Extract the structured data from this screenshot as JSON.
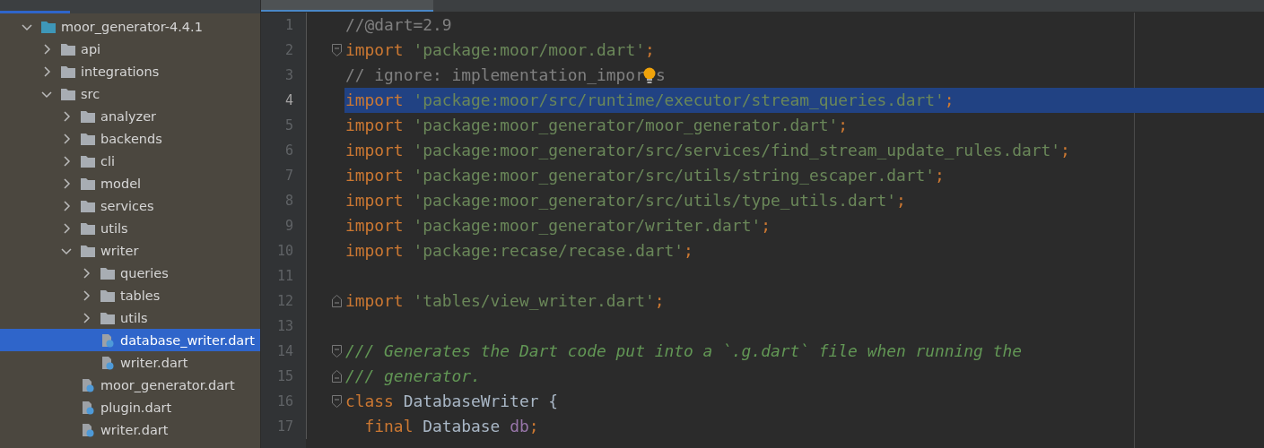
{
  "project_tree": [
    {
      "label": "moor_generator-4.4.1",
      "kind": "module",
      "expanded": true,
      "selected": false,
      "children": [
        {
          "label": "api",
          "kind": "folder",
          "expanded": false,
          "selected": false
        },
        {
          "label": "integrations",
          "kind": "folder",
          "expanded": false,
          "selected": false
        },
        {
          "label": "src",
          "kind": "folder",
          "expanded": true,
          "selected": false,
          "children": [
            {
              "label": "analyzer",
              "kind": "folder",
              "expanded": false,
              "selected": false
            },
            {
              "label": "backends",
              "kind": "folder",
              "expanded": false,
              "selected": false
            },
            {
              "label": "cli",
              "kind": "folder",
              "expanded": false,
              "selected": false
            },
            {
              "label": "model",
              "kind": "folder",
              "expanded": false,
              "selected": false
            },
            {
              "label": "services",
              "kind": "folder",
              "expanded": false,
              "selected": false
            },
            {
              "label": "utils",
              "kind": "folder",
              "expanded": false,
              "selected": false
            },
            {
              "label": "writer",
              "kind": "folder",
              "expanded": true,
              "selected": false,
              "children": [
                {
                  "label": "queries",
                  "kind": "folder",
                  "expanded": false,
                  "selected": false
                },
                {
                  "label": "tables",
                  "kind": "folder",
                  "expanded": false,
                  "selected": false
                },
                {
                  "label": "utils",
                  "kind": "folder",
                  "expanded": false,
                  "selected": false
                },
                {
                  "label": "database_writer.dart",
                  "kind": "file",
                  "selected": true
                },
                {
                  "label": "writer.dart",
                  "kind": "file",
                  "selected": false
                }
              ]
            },
            {
              "label": "moor_generator.dart",
              "kind": "file",
              "selected": false
            },
            {
              "label": "plugin.dart",
              "kind": "file",
              "selected": false
            },
            {
              "label": "writer.dart",
              "kind": "file",
              "selected": false
            }
          ]
        }
      ]
    }
  ],
  "editor": {
    "lines": [
      {
        "number": "1",
        "highlighted": false,
        "tokens": [
          {
            "kind": "comment",
            "text": "//@dart=2.9"
          }
        ]
      },
      {
        "number": "2",
        "highlighted": false,
        "fold_open": true,
        "tokens": [
          {
            "kind": "keyword",
            "text": "import"
          },
          {
            "kind": "string",
            "text": " 'package:moor/moor.dart'"
          },
          {
            "kind": "keyword",
            "text": ";"
          }
        ]
      },
      {
        "number": "3",
        "highlighted": false,
        "tokens": [
          {
            "kind": "comment",
            "text": "// ignore: implementation_impor"
          },
          {
            "kind": "bulb"
          },
          {
            "kind": "comment",
            "text": "s"
          }
        ]
      },
      {
        "number": "4",
        "highlighted": true,
        "tokens": [
          {
            "kind": "keyword",
            "text": "import"
          },
          {
            "kind": "string",
            "text": " 'package:moor/src/runtime/executor/stream_queries.dart'"
          },
          {
            "kind": "keyword",
            "text": ";"
          }
        ]
      },
      {
        "number": "5",
        "highlighted": false,
        "tokens": [
          {
            "kind": "keyword",
            "text": "import"
          },
          {
            "kind": "string",
            "text": " 'package:moor_generator/moor_generator.dart'"
          },
          {
            "kind": "keyword",
            "text": ";"
          }
        ]
      },
      {
        "number": "6",
        "highlighted": false,
        "tokens": [
          {
            "kind": "keyword",
            "text": "import"
          },
          {
            "kind": "string",
            "text": " 'package:moor_generator/src/services/find_stream_update_rules.dart'"
          },
          {
            "kind": "keyword",
            "text": ";"
          }
        ]
      },
      {
        "number": "7",
        "highlighted": false,
        "tokens": [
          {
            "kind": "keyword",
            "text": "import"
          },
          {
            "kind": "string",
            "text": " 'package:moor_generator/src/utils/string_escaper.dart'"
          },
          {
            "kind": "keyword",
            "text": ";"
          }
        ]
      },
      {
        "number": "8",
        "highlighted": false,
        "tokens": [
          {
            "kind": "keyword",
            "text": "import"
          },
          {
            "kind": "string",
            "text": " 'package:moor_generator/src/utils/type_utils.dart'"
          },
          {
            "kind": "keyword",
            "text": ";"
          }
        ]
      },
      {
        "number": "9",
        "highlighted": false,
        "tokens": [
          {
            "kind": "keyword",
            "text": "import"
          },
          {
            "kind": "string",
            "text": " 'package:moor_generator/writer.dart'"
          },
          {
            "kind": "keyword",
            "text": ";"
          }
        ]
      },
      {
        "number": "10",
        "highlighted": false,
        "tokens": [
          {
            "kind": "keyword",
            "text": "import"
          },
          {
            "kind": "string",
            "text": " 'package:recase/recase.dart'"
          },
          {
            "kind": "keyword",
            "text": ";"
          }
        ]
      },
      {
        "number": "11",
        "highlighted": false
      },
      {
        "number": "12",
        "highlighted": false,
        "fold_close": true,
        "tokens": [
          {
            "kind": "keyword",
            "text": "import"
          },
          {
            "kind": "string",
            "text": " 'tables/view_writer.dart'"
          },
          {
            "kind": "keyword",
            "text": ";"
          }
        ]
      },
      {
        "number": "13",
        "highlighted": false
      },
      {
        "number": "14",
        "highlighted": false,
        "fold_open": true,
        "tokens": [
          {
            "kind": "doc",
            "text": "/// Generates the Dart code put into a `.g.dart` file when running the"
          }
        ]
      },
      {
        "number": "15",
        "highlighted": false,
        "fold_close": true,
        "tokens": [
          {
            "kind": "doc",
            "text": "/// generator."
          }
        ]
      },
      {
        "number": "16",
        "highlighted": false,
        "fold_open": true,
        "tokens": [
          {
            "kind": "keyword",
            "text": "class"
          },
          {
            "kind": "plain",
            "text": " DatabaseWriter {"
          }
        ]
      },
      {
        "number": "17",
        "highlighted": false,
        "tokens": [
          {
            "kind": "keyword",
            "text": "  final"
          },
          {
            "kind": "plain",
            "text": " Database "
          },
          {
            "kind": "field",
            "text": "db"
          },
          {
            "kind": "keyword",
            "text": ";"
          }
        ]
      }
    ]
  }
}
